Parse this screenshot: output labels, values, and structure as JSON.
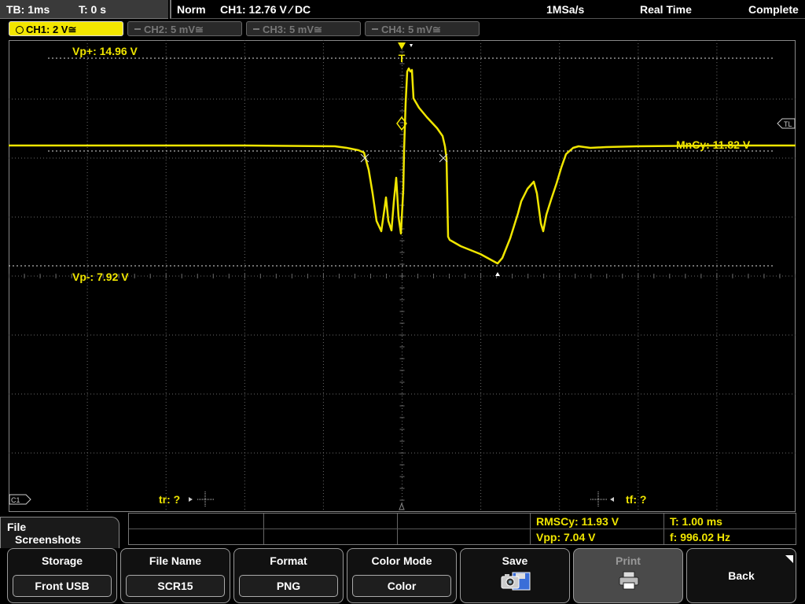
{
  "status_bar": {
    "timebase": "TB: 1ms",
    "trigger_time": "T: 0 s",
    "trigger_mode": "Norm",
    "trigger_info": "CH1: 12.76 V ⁄ DC",
    "sample_rate": "1MSa/s",
    "acq_mode": "Real Time",
    "acq_state": "Complete"
  },
  "channels": [
    {
      "label": "CH1: 2 V≅",
      "active": true
    },
    {
      "label": "CH2: 5 mV≅",
      "active": false
    },
    {
      "label": "CH3: 5 mV≅",
      "active": false
    },
    {
      "label": "CH4: 5 mV≅",
      "active": false
    }
  ],
  "cursors": {
    "vp_plus": "Vp+: 14.96 V",
    "vp_minus": "Vp-: 7.92 V",
    "mncy": "MnCy: 11.82 V",
    "tr": "tr: ?",
    "tf": "tf: ?",
    "trigger_marker": "T",
    "trigger_level_marker": "TL",
    "channel_marker": "C1"
  },
  "measurements": {
    "rmscy": "RMSCy: 11.93 V",
    "vpp": "Vpp: 7.04 V",
    "period": "T: 1.00 ms",
    "freq": "f: 996.02 Hz"
  },
  "menu": {
    "line1": "File",
    "line2": "Screenshots"
  },
  "softkeys": {
    "storage_label": "Storage",
    "storage_value": "Front USB",
    "filename_label": "File Name",
    "filename_value": "SCR15",
    "format_label": "Format",
    "format_value": "PNG",
    "colormode_label": "Color Mode",
    "colormode_value": "Color",
    "save_label": "Save",
    "print_label": "Print",
    "back_label": "Back"
  },
  "colors": {
    "trace": "#f0e600",
    "grid": "#6a6a6a",
    "background": "#000000"
  }
}
